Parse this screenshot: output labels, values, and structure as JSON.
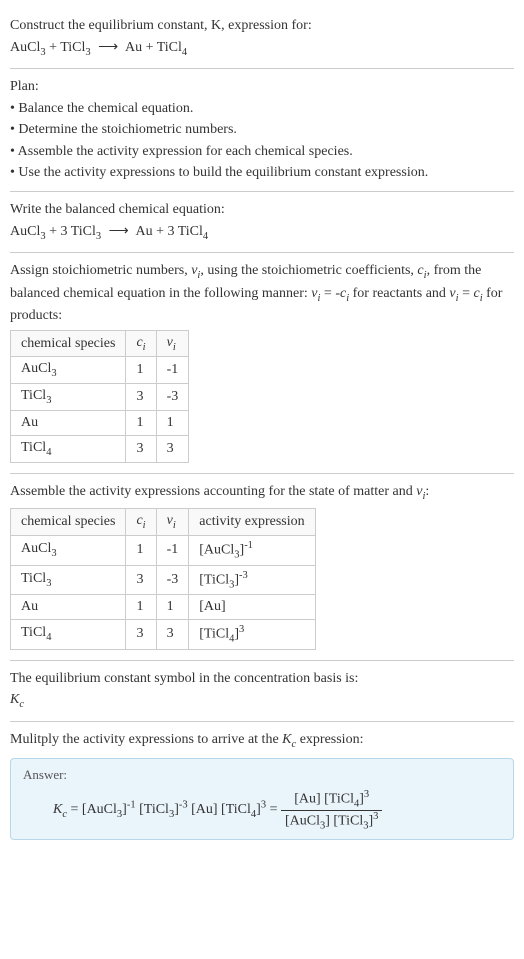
{
  "header": {
    "line1": "Construct the equilibrium constant, K, expression for:",
    "equation": "AuCl₃ + TiCl₃ ⟶ Au + TiCl₄"
  },
  "plan": {
    "title": "Plan:",
    "items": [
      "• Balance the chemical equation.",
      "• Determine the stoichiometric numbers.",
      "• Assemble the activity expression for each chemical species.",
      "• Use the activity expressions to build the equilibrium constant expression."
    ]
  },
  "balanced": {
    "title": "Write the balanced chemical equation:",
    "equation": "AuCl₃ + 3 TiCl₃ ⟶ Au + 3 TiCl₄"
  },
  "stoich": {
    "intro_a": "Assign stoichiometric numbers, νᵢ, using the stoichiometric coefficients, cᵢ, from the balanced chemical equation in the following manner: νᵢ = -cᵢ for reactants and νᵢ = cᵢ for products:",
    "headers": [
      "chemical species",
      "cᵢ",
      "νᵢ"
    ],
    "rows": [
      {
        "sp": "AuCl₃",
        "c": "1",
        "v": "-1"
      },
      {
        "sp": "TiCl₃",
        "c": "3",
        "v": "-3"
      },
      {
        "sp": "Au",
        "c": "1",
        "v": "1"
      },
      {
        "sp": "TiCl₄",
        "c": "3",
        "v": "3"
      }
    ]
  },
  "activity": {
    "intro": "Assemble the activity expressions accounting for the state of matter and νᵢ:",
    "headers": [
      "chemical species",
      "cᵢ",
      "νᵢ",
      "activity expression"
    ],
    "rows": [
      {
        "sp": "AuCl₃",
        "c": "1",
        "v": "-1",
        "ae": "[AuCl₃]⁻¹"
      },
      {
        "sp": "TiCl₃",
        "c": "3",
        "v": "-3",
        "ae": "[TiCl₃]⁻³"
      },
      {
        "sp": "Au",
        "c": "1",
        "v": "1",
        "ae": "[Au]"
      },
      {
        "sp": "TiCl₄",
        "c": "3",
        "v": "3",
        "ae": "[TiCl₄]³"
      }
    ]
  },
  "kc_symbol": {
    "line1": "The equilibrium constant symbol in the concentration basis is:",
    "line2": "K𝚌"
  },
  "multiply": {
    "title": "Mulitply the activity expressions to arrive at the K𝚌 expression:"
  },
  "answer": {
    "label": "Answer:",
    "lhs": "K𝚌 = [AuCl₃]⁻¹ [TiCl₃]⁻³ [Au] [TiCl₄]³ = ",
    "num": "[Au] [TiCl₄]³",
    "den": "[AuCl₃] [TiCl₃]³"
  }
}
